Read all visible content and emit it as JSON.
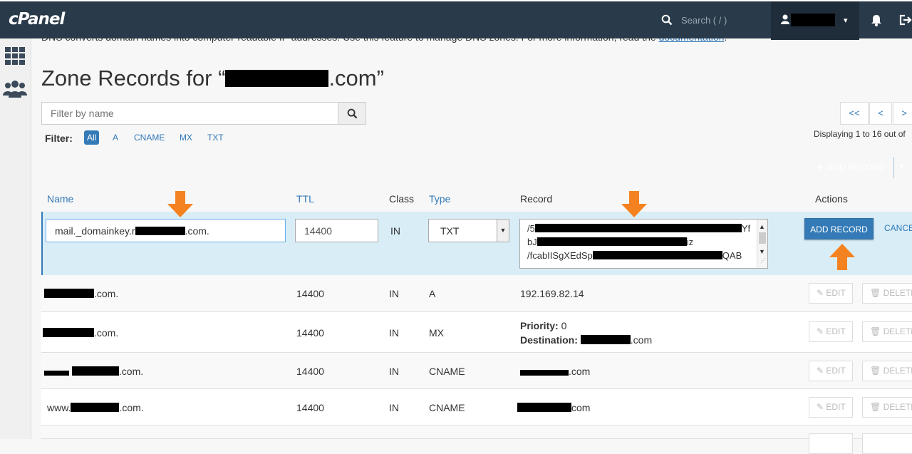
{
  "app": {
    "logo": "cPanel"
  },
  "header": {
    "search_placeholder": "Search ( / )",
    "user_caret": "▾"
  },
  "intro": {
    "text": "DNS converts domain names into computer-readable IP addresses. Use this feature to manage DNS zones. For more information, read the ",
    "link": "documentation",
    "end": "."
  },
  "title": {
    "prefix": "Zone Records for “",
    "suffix": ".com”"
  },
  "filter": {
    "placeholder": "Filter by name",
    "label": "Filter:",
    "chips": [
      "All",
      "A",
      "CNAME",
      "MX",
      "TXT"
    ]
  },
  "pager": {
    "first": "<<",
    "prev": "<",
    "next": ">",
    "display_text": "Displaying 1 to 16 out of"
  },
  "add_record_top": {
    "label": "ADD RECORD"
  },
  "table": {
    "headers": {
      "name": "Name",
      "ttl": "TTL",
      "class": "Class",
      "type": "Type",
      "record": "Record",
      "actions": "Actions"
    }
  },
  "edit_row": {
    "name_prefix": "mail._domainkey.r",
    "name_suffix": ".com.",
    "ttl": "14400",
    "class": "IN",
    "type": "TXT",
    "record_lines": [
      "/5",
      "bJ",
      "/fcabIISgXEdSp"
    ],
    "record_line1_end": "Yf",
    "record_line2_end": "iz",
    "record_line3_end": "QAB",
    "add_button": "ADD RECORD",
    "cancel": "CANCEL"
  },
  "rows": [
    {
      "name": ".com.",
      "ttl": "14400",
      "class": "IN",
      "type": "A",
      "record": "192.169.82.14"
    },
    {
      "name": ".com.",
      "ttl": "14400",
      "class": "IN",
      "type": "MX",
      "priority_label": "Priority:",
      "priority": "0",
      "dest_label": "Destination:",
      "dest": ".com"
    },
    {
      "name": ".com.",
      "ttl": "14400",
      "class": "IN",
      "type": "CNAME",
      "record": ".com"
    },
    {
      "name_prefix": "www.",
      "name": ".com.",
      "ttl": "14400",
      "class": "IN",
      "type": "CNAME",
      "record": "com"
    }
  ],
  "actions": {
    "edit": "EDIT",
    "delete": "DELETE"
  },
  "colors": {
    "header_bg": "#293a4a",
    "accent": "#337ab7",
    "edit_row_bg": "#d9edf7",
    "annotation_arrow": "#f58220"
  }
}
